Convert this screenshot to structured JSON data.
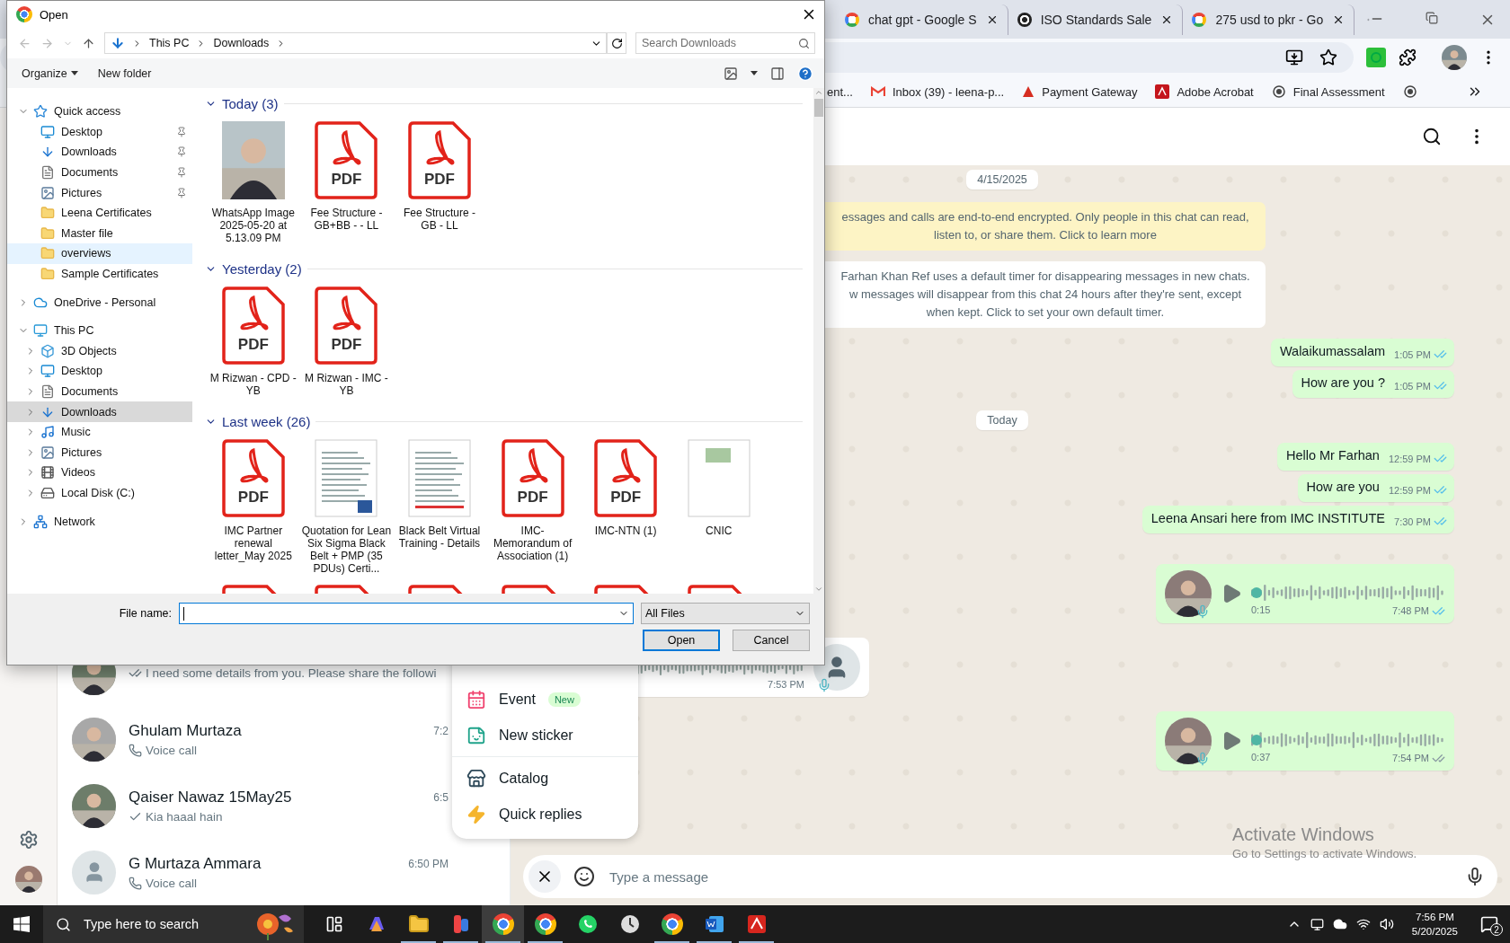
{
  "browser": {
    "tabs": [
      {
        "title": "chat gpt - Google S",
        "kind": "google",
        "selected": false
      },
      {
        "title": "ISO Standards Sale",
        "kind": "openai",
        "selected": false
      },
      {
        "title": "275 usd to pkr - Go",
        "kind": "google",
        "selected": false
      }
    ],
    "bookmarks": [
      {
        "label": "ent...",
        "kind": "plain"
      },
      {
        "label": "Inbox (39) - leena-p...",
        "kind": "gmail"
      },
      {
        "label": "Payment Gateway",
        "kind": "payment"
      },
      {
        "label": "Adobe Acrobat",
        "kind": "acrobat"
      },
      {
        "label": "Final Assessment",
        "kind": "seal"
      },
      {
        "kind": "seal"
      }
    ]
  },
  "whatsapp": {
    "chats": [
      {
        "preview": "I need some details from you. Please share the followi",
        "kind": "read"
      },
      {
        "name": "Ghulam Murtaza",
        "preview": "Voice call",
        "time": "7:2",
        "kind": "call"
      },
      {
        "name": "Qaiser Nawaz 15May25",
        "preview": "Kia haaal hain",
        "time": "6:5",
        "kind": "sent"
      },
      {
        "name": "G Murtaza Ammara",
        "preview": "Voice call",
        "time": "6:50 PM",
        "kind": "call",
        "avatar": {
          "kind": "default"
        }
      }
    ],
    "messages": [
      {
        "kind": "date",
        "text": "4/15/2025"
      },
      {
        "kind": "warning-notice",
        "text": "essages and calls are end-to-end encrypted. Only people in this chat can read, listen to, or share them. Click to learn more"
      },
      {
        "kind": "notice",
        "text": "Farhan Khan Ref uses a default timer for disappearing messages in new chats. w messages will disappear from this chat 24 hours after they're sent, except when kept. Click to set your own default timer."
      },
      {
        "kind": "text",
        "outgoing": true,
        "text": "Walaikumassalam",
        "time": "1:05 PM",
        "read": true
      },
      {
        "kind": "text",
        "outgoing": true,
        "text": "How are you ?",
        "time": "1:05 PM",
        "read": true
      },
      {
        "kind": "date",
        "text": "Today"
      },
      {
        "kind": "text",
        "outgoing": true,
        "text": "Hello Mr Farhan",
        "time": "12:59 PM",
        "read": true
      },
      {
        "kind": "text",
        "outgoing": true,
        "text": "How are you",
        "time": "12:59 PM",
        "read": true
      },
      {
        "kind": "text",
        "outgoing": true,
        "text": "Leena Ansari here from IMC INSTITUTE",
        "time": "7:30 PM",
        "read": true
      },
      {
        "kind": "voice",
        "outgoing": true,
        "duration": "0:15",
        "time": "7:48 PM",
        "read": true
      },
      {
        "kind": "voice",
        "outgoing": false,
        "time": "7:53 PM"
      },
      {
        "kind": "voice",
        "outgoing": true,
        "duration": "0:37",
        "time": "7:54 PM",
        "read": false
      }
    ],
    "composer": {
      "placeholder": "Type a message"
    },
    "attach_menu": [
      [
        {
          "label": "Event",
          "kind": "event",
          "badge": "New"
        },
        {
          "label": "New sticker",
          "kind": "sticker"
        }
      ],
      [
        {
          "label": "Catalog",
          "kind": "catalog"
        },
        {
          "label": "Quick replies",
          "kind": "quick"
        }
      ]
    ]
  },
  "dialog": {
    "title": "Open",
    "path": [
      "This PC",
      "Downloads"
    ],
    "search": {
      "placeholder": "Search Downloads"
    },
    "commands": [
      {
        "label": "Organize",
        "menu": true
      },
      {
        "label": "New folder",
        "menu": false
      }
    ],
    "nav": [
      {
        "label": "Quick access",
        "kind": "star",
        "expanded": true,
        "selected": false,
        "hovered": false,
        "children": [
          {
            "label": "Desktop",
            "kind": "desktop",
            "pinned": true,
            "selected": false,
            "hovered": false
          },
          {
            "label": "Downloads",
            "kind": "download",
            "pinned": true,
            "selected": false,
            "hovered": false
          },
          {
            "label": "Documents",
            "kind": "documents",
            "pinned": true,
            "selected": false,
            "hovered": false
          },
          {
            "label": "Pictures",
            "kind": "pictures",
            "pinned": true,
            "selected": false,
            "hovered": false
          },
          {
            "label": "Leena Certificates",
            "kind": "folder",
            "pinned": false,
            "selected": false,
            "hovered": false
          },
          {
            "label": "Master file",
            "kind": "folder",
            "pinned": false,
            "selected": false,
            "hovered": false
          },
          {
            "label": "overviews",
            "kind": "folder",
            "pinned": false,
            "selected": false,
            "hovered": true
          },
          {
            "label": "Sample Certificates",
            "kind": "folder",
            "pinned": false,
            "selected": false,
            "hovered": false
          }
        ]
      },
      {
        "label": "OneDrive - Personal",
        "kind": "cloud",
        "expanded": false,
        "selected": false,
        "hovered": false
      },
      {
        "label": "This PC",
        "kind": "pc",
        "expanded": true,
        "selected": false,
        "hovered": false,
        "children": [
          {
            "label": "3D Objects",
            "kind": "cube",
            "expanded": false,
            "selected": false,
            "hovered": false
          },
          {
            "label": "Desktop",
            "kind": "desktop",
            "expanded": false,
            "selected": false,
            "hovered": false
          },
          {
            "label": "Documents",
            "kind": "documents",
            "expanded": false,
            "selected": false,
            "hovered": false
          },
          {
            "label": "Downloads",
            "kind": "download",
            "expanded": false,
            "selected": true,
            "hovered": false
          },
          {
            "label": "Music",
            "kind": "music",
            "expanded": false,
            "selected": false,
            "hovered": false
          },
          {
            "label": "Pictures",
            "kind": "pictures",
            "expanded": false,
            "selected": false,
            "hovered": false
          },
          {
            "label": "Videos",
            "kind": "videos",
            "expanded": false,
            "selected": false,
            "hovered": false
          },
          {
            "label": "Local Disk (C:)",
            "kind": "drive",
            "expanded": false,
            "selected": false,
            "hovered": false
          }
        ]
      },
      {
        "label": "Network",
        "kind": "network",
        "expanded": false,
        "selected": false,
        "hovered": false
      }
    ],
    "groups": [
      {
        "label": "Today (3)",
        "expanded": true,
        "files": [
          {
            "name": "WhatsApp Image 2025-05-20 at 5.13.09 PM"
          },
          {
            "name": "Fee Structure - GB+BB - - LL",
            "kind": "pdf",
            "icon_text": "PDF"
          },
          {
            "name": "Fee Structure - GB - LL",
            "kind": "pdf",
            "icon_text": "PDF"
          }
        ]
      },
      {
        "label": "Yesterday (2)",
        "expanded": true,
        "files": [
          {
            "name": "M Rizwan - CPD - YB",
            "kind": "pdf",
            "icon_text": "PDF"
          },
          {
            "name": "M Rizwan - IMC - YB",
            "kind": "pdf",
            "icon_text": "PDF"
          }
        ]
      },
      {
        "label": "Last week (26)",
        "expanded": true,
        "files": [
          {
            "name": "IMC Partner renewal letter_May 2025",
            "kind": "pdf",
            "icon_text": "PDF"
          },
          {
            "name": "Quotation for Lean Six Sigma Black Belt + PMP (35 PDUs) Certi...",
            "kind": "word"
          },
          {
            "name": "Black Belt Virtual Training - Details",
            "kind": "sheet"
          },
          {
            "name": "IMC-Memorandum of Association (1)",
            "kind": "pdf",
            "icon_text": "PDF"
          },
          {
            "name": "IMC-NTN (1)",
            "kind": "pdf",
            "icon_text": "PDF"
          },
          {
            "name": "CNIC",
            "kind": "card"
          },
          {
            "kind": "pdf"
          },
          {
            "kind": "pdf"
          },
          {
            "kind": "pdf"
          },
          {
            "kind": "pdf"
          },
          {
            "kind": "pdf"
          },
          {
            "kind": "pdf"
          }
        ]
      }
    ],
    "file_name": {
      "label": "File name:"
    },
    "file_type": "All Files",
    "buttons": [
      {
        "label": "Open",
        "default": true
      },
      {
        "label": "Cancel",
        "default": false
      }
    ]
  },
  "windows_notice": {
    "title": "Activate Windows",
    "text": "Go to Settings to activate Windows."
  },
  "taskbar": {
    "search": {
      "placeholder": "Type here to search"
    },
    "apps": [
      {
        "kind": "task-view",
        "running": false,
        "selected": false
      },
      {
        "kind": "copilot",
        "running": false,
        "selected": false
      },
      {
        "kind": "explorer",
        "running": true,
        "selected": false
      },
      {
        "kind": "app",
        "running": true,
        "selected": false
      },
      {
        "kind": "chrome",
        "running": true,
        "selected": true
      },
      {
        "kind": "chrome",
        "running": true,
        "selected": false
      },
      {
        "kind": "whatsapp",
        "running": false,
        "selected": false
      },
      {
        "kind": "clock",
        "running": false,
        "selected": false
      },
      {
        "kind": "chrome",
        "running": true,
        "selected": false
      },
      {
        "kind": "word",
        "running": true,
        "selected": false
      },
      {
        "kind": "acrobat",
        "running": true,
        "selected": false
      }
    ],
    "time": "7:56 PM",
    "date": "5/20/2025",
    "notifications": "2"
  }
}
